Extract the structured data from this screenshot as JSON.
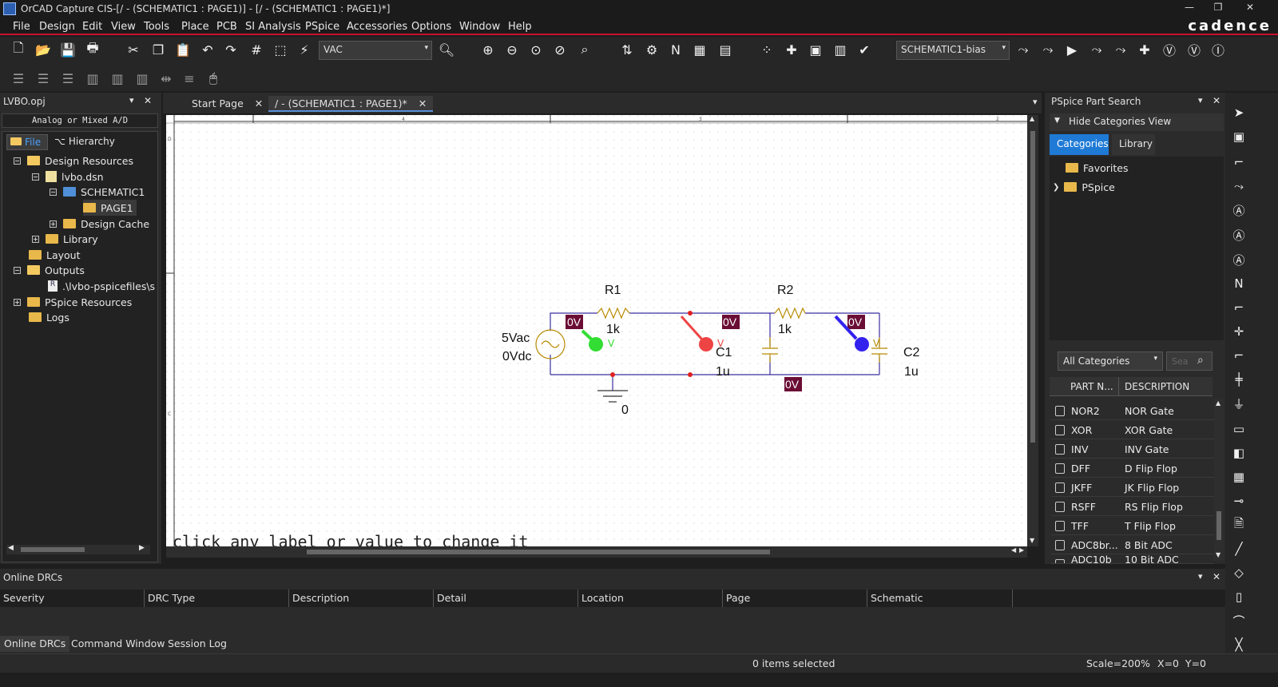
{
  "window": {
    "title": "OrCAD Capture CIS-[/ - (SCHEMATIC1 : PAGE1)] - [/ - (SCHEMATIC1 : PAGE1)*]",
    "brand": "cadence"
  },
  "menu": [
    "File",
    "Design",
    "Edit",
    "View",
    "Tools",
    "Place",
    "PCB",
    "SI Analysis",
    "PSpice",
    "Accessories",
    "Options",
    "Window",
    "Help"
  ],
  "toolbar": {
    "part_combo": "VAC",
    "profile_combo": "SCHEMATIC1-bias"
  },
  "project": {
    "title": "LVBO.opj",
    "mode": "Analog or Mixed A/D",
    "tabs": {
      "file": "File",
      "hierarchy": "Hierarchy"
    },
    "tree": [
      "Design Resources",
      "lvbo.dsn",
      "SCHEMATIC1",
      "PAGE1",
      "Design Cache",
      "Library",
      "Layout",
      "Outputs",
      ".\\lvbo-pspicefiles\\s",
      "PSpice Resources",
      "Logs"
    ]
  },
  "doc_tabs": [
    "Start Page",
    "/ - (SCHEMATIC1 : PAGE1)*"
  ],
  "schematic": {
    "ruler": [
      "4",
      "3",
      "2"
    ],
    "left_ruler": [
      "D",
      "C"
    ],
    "hint": "click any label or value to change it",
    "source": {
      "amp": "5Vac",
      "dc": "0Vdc"
    },
    "r1": {
      "name": "R1",
      "value": "1k"
    },
    "r2": {
      "name": "R2",
      "value": "1k"
    },
    "c1": {
      "name": "C1",
      "value": "1u"
    },
    "c2": {
      "name": "C2",
      "value": "1u"
    },
    "ground": "0",
    "voltage_markers": [
      "0V",
      "0V",
      "0V",
      "0V"
    ],
    "probe_letter": "V",
    "probe_colors": {
      "green": "#33dd33",
      "red": "#ee4444",
      "blue": "#3322ee"
    }
  },
  "part_search": {
    "title": "PSpice Part Search",
    "hide_label": "Hide Categories View",
    "tabs": [
      "Categories",
      "Library"
    ],
    "categories": [
      "Favorites",
      "PSpice"
    ],
    "filter": "All Categories",
    "search_placeholder": "Sea",
    "columns": [
      "PART N...",
      "DESCRIPTION"
    ],
    "rows": [
      {
        "name": "NOR2",
        "desc": "NOR Gate"
      },
      {
        "name": "XOR",
        "desc": "XOR Gate"
      },
      {
        "name": "INV",
        "desc": "INV Gate"
      },
      {
        "name": "DFF",
        "desc": "D Flip Flop"
      },
      {
        "name": "JKFF",
        "desc": "JK Flip Flop"
      },
      {
        "name": "RSFF",
        "desc": "RS Flip Flop"
      },
      {
        "name": "TFF",
        "desc": "T Flip Flop"
      },
      {
        "name": "ADC8br...",
        "desc": "8 Bit ADC"
      },
      {
        "name": "ADC10b",
        "desc": "10 Bit ADC"
      }
    ]
  },
  "drc": {
    "title": "Online DRCs",
    "columns": [
      "Severity",
      "DRC Type",
      "Description",
      "Detail",
      "Location",
      "Page",
      "Schematic"
    ]
  },
  "bottom_tabs": [
    "Online DRCs",
    "Command Window",
    "Session Log"
  ],
  "status": {
    "selection": "0 items selected",
    "scale": "Scale=200%",
    "coords": "X=0  Y=0"
  }
}
